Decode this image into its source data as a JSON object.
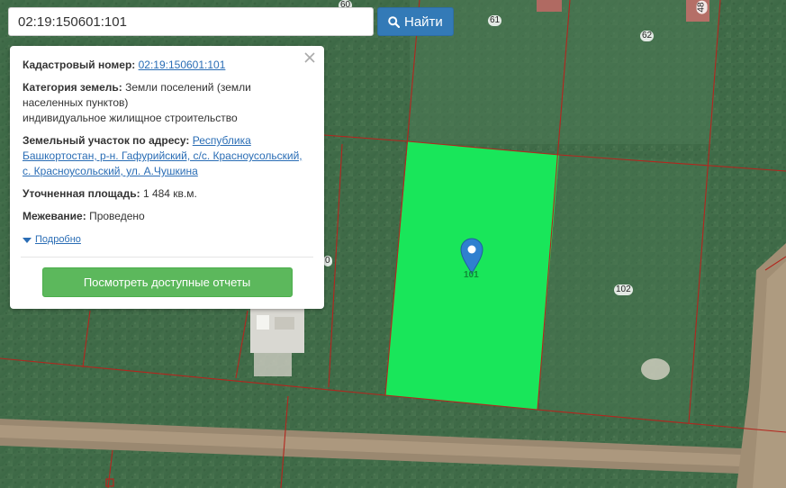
{
  "search": {
    "value": "02:19:150601:101",
    "button_label": "Найти"
  },
  "popup": {
    "cadastral_label": "Кадастровый номер:",
    "cadastral_value": "02:19:150601:101",
    "category_label": "Категория земель:",
    "category_value_line1": "Земли поселений (земли",
    "category_value_line2": "населенных пунктов)",
    "category_value_line3": "индивидуальное жилищное строительство",
    "address_label": "Земельный участок по адресу:",
    "address_value_part1": "Республика",
    "address_value_part2": "Башкортостан, р-н. Гафурийский, с/с. Красноусольский,",
    "address_value_part3": "с. Красноусольский, ул. А.Чушкина",
    "area_label": "Уточненная площадь:",
    "area_value": "1 484 кв.м.",
    "survey_label": "Межевание:",
    "survey_value": "Проведено",
    "more_label": "Подробно",
    "report_button_label": "Посмотреть доступные отчеты"
  },
  "map": {
    "parcel_labels": [
      "61",
      "62",
      "102",
      "101",
      "60",
      "48",
      "0"
    ],
    "colors": {
      "parcel_highlight": "#19e65a",
      "boundary": "#b3261e",
      "marker": "#2f80cf",
      "button_primary": "#337ab7",
      "button_success": "#5cb85c"
    },
    "icons": [
      "search-icon",
      "close-icon",
      "map-marker-icon",
      "caret-down-icon"
    ]
  }
}
